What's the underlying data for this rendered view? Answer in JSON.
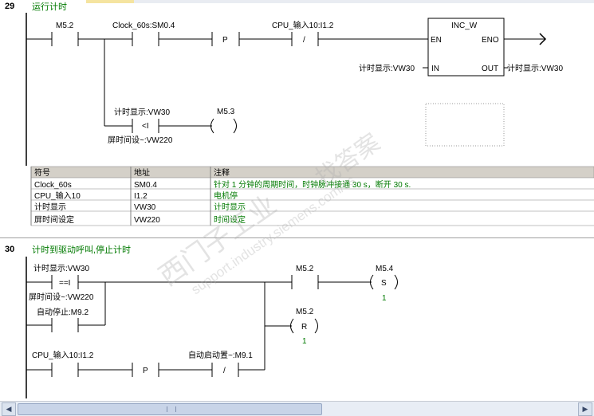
{
  "networks": [
    {
      "number": "29",
      "title": "运行计时",
      "contacts": {
        "m52": "M5.2",
        "clock": "Clock_60s:SM0.4",
        "cpu_in": "CPU_输入10:I1.2",
        "p_label": "P",
        "not_label": "/"
      },
      "box": {
        "name": "INC_W",
        "en": "EN",
        "eno": "ENO",
        "in": "IN",
        "out": "OUT",
        "in_operand": "计时显示:VW30",
        "out_operand": "计时显示:VW30"
      },
      "compare": {
        "top": "计时显示:VW30",
        "op": "<I",
        "bottom": "屏时间设~:VW220"
      },
      "coil": "M5.3",
      "symbol_table": {
        "headers": [
          "符号",
          "地址",
          "注释"
        ],
        "rows": [
          [
            "Clock_60s",
            "SM0.4",
            "针对 1 分钟的周期时间，时钟脉冲接通 30 s，断开 30 s."
          ],
          [
            "CPU_输入10",
            "I1.2",
            "电机停"
          ],
          [
            "计时显示",
            "VW30",
            "计时显示"
          ],
          [
            "屏时间设定",
            "VW220",
            "时间设定"
          ]
        ]
      }
    },
    {
      "number": "30",
      "title": "计时到驱动呼叫,停止计时",
      "compare": {
        "top": "计时显示:VW30",
        "op": "==I",
        "bottom": "屏时间设~:VW220"
      },
      "contacts": {
        "auto_stop": "自动停止:M9.2",
        "cpu_in": "CPU_输入10:I1.2",
        "p_label": "P",
        "auto_start": "自动启动置~:M9.1",
        "not_label": "/",
        "m52": "M5.2"
      },
      "coils": {
        "set": {
          "addr": "M5.4",
          "type": "S",
          "count": "1"
        },
        "reset": {
          "addr": "M5.2",
          "type": "R",
          "count": "1"
        }
      }
    }
  ],
  "watermark": {
    "text1": "西门子工业",
    "text2": "support.industry.siemens.com/cs",
    "text3": "找答案"
  },
  "colors": {
    "title_green": "#007a00",
    "table_header_bg": "#d4d0c8",
    "wire": "#000000",
    "watermark": "#c8c8c8"
  }
}
